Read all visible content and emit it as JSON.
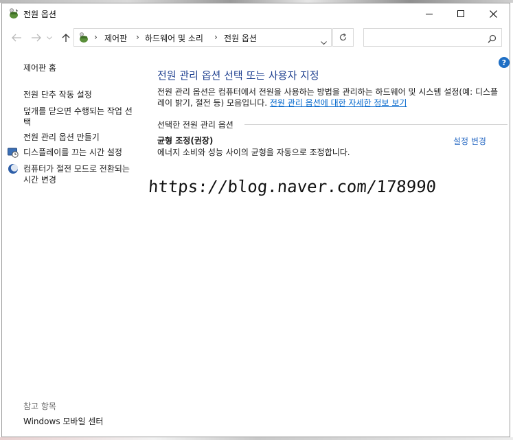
{
  "window": {
    "title": "전원 옵션"
  },
  "navigation": {
    "breadcrumbs": [
      {
        "label": "제어판"
      },
      {
        "label": "하드웨어 및 소리"
      },
      {
        "label": "전원 옵션"
      }
    ],
    "search_placeholder": ""
  },
  "sidebar": {
    "home_link": "제어판 홈",
    "links": [
      {
        "label": "전원 단추 작동 설정"
      },
      {
        "label": "덮개를 닫으면 수행되는 작업 선택"
      },
      {
        "label": "전원 관리 옵션 만들기"
      },
      {
        "label": "디스플레이를 끄는 시간 설정"
      },
      {
        "label": "컴퓨터가 절전 모드로 전환되는 시간 변경"
      }
    ],
    "see_also_heading": "참고 항목",
    "see_also_links": [
      {
        "label": "Windows 모바일 센터"
      }
    ]
  },
  "main": {
    "title": "전원 관리 옵션 선택 또는 사용자 지정",
    "description": "전원 관리 옵션은 컴퓨터에서 전원을 사용하는 방법을 관리하는 하드웨어 및 시스템 설정(예: 디스플레이 밝기, 절전 등) 모음입니다. ",
    "description_link": "전원 관리 옵션에 대한 자세한 정보 보기",
    "selected_plans_heading": "선택한 전원 관리 옵션",
    "plan": {
      "name": "균형 조정(권장)",
      "description": "에너지 소비와 성능 사이의 균형을 자동으로 조정합니다.",
      "change_link": "설정 변경"
    }
  },
  "watermark": "https://blog.naver.com/178990",
  "colors": {
    "title_blue": "#1e3f8f",
    "link_blue": "#0066cc",
    "help_blue": "#1f6fc5"
  },
  "icons": {
    "app": "power-options-icon",
    "help": "help-icon",
    "search": "search-icon",
    "refresh": "refresh-icon"
  }
}
